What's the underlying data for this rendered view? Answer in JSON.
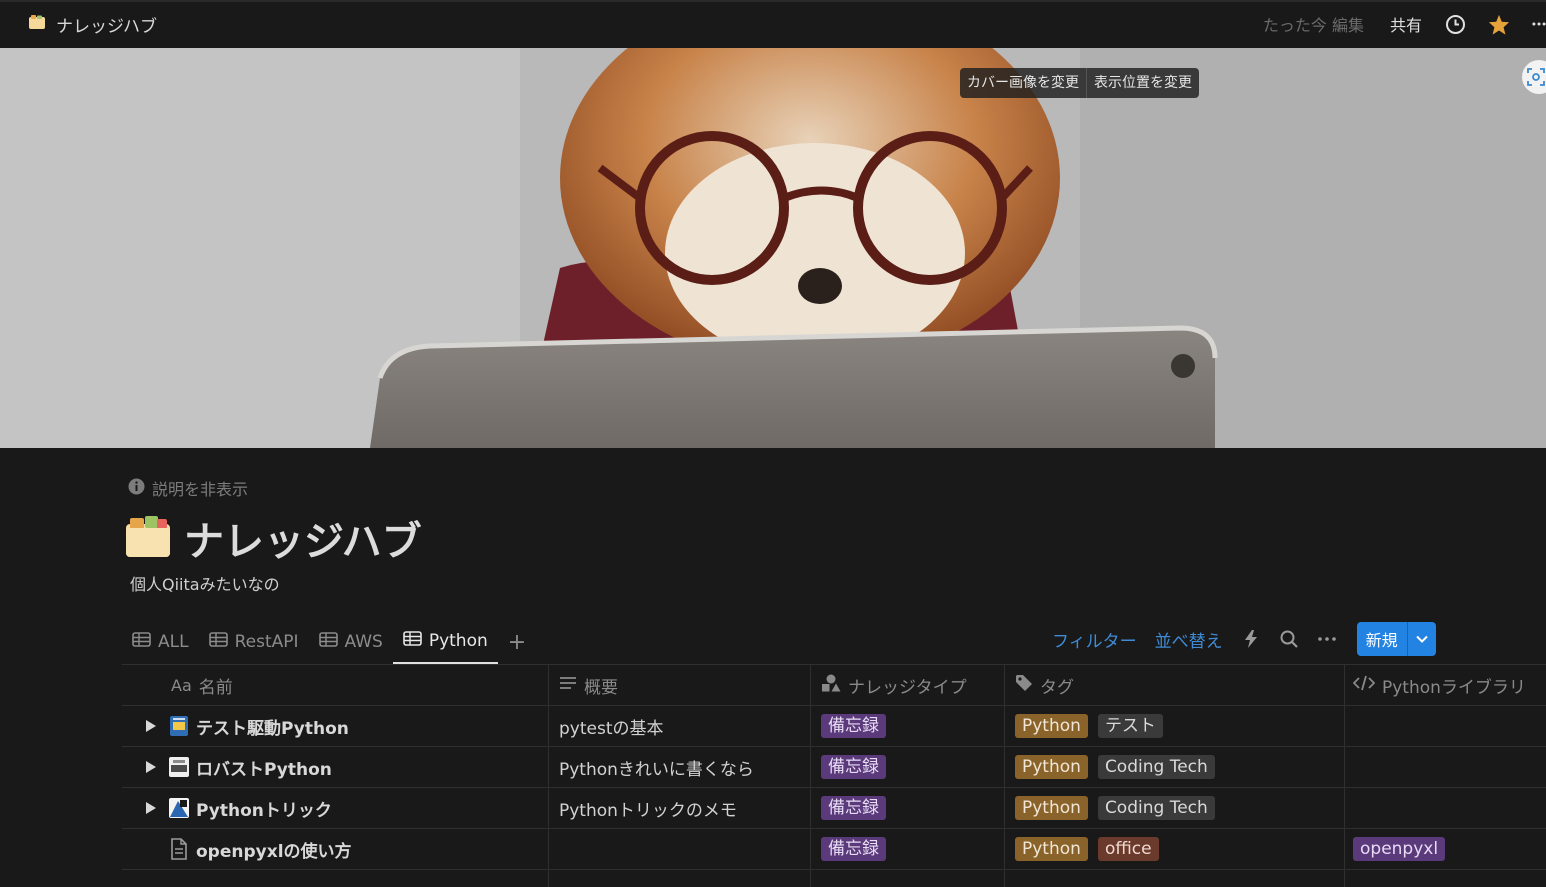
{
  "topbar": {
    "breadcrumb": "ナレッジハブ",
    "edited": "たった今 編集",
    "share": "共有"
  },
  "cover": {
    "change_cover": "カバー画像を変更",
    "reposition": "表示位置を変更"
  },
  "page": {
    "hide_description": "説明を非表示",
    "title": "ナレッジハブ",
    "description": "個人Qiitaみたいなの"
  },
  "views": {
    "tabs": [
      {
        "label": "ALL"
      },
      {
        "label": "RestAPI"
      },
      {
        "label": "AWS"
      },
      {
        "label": "Python",
        "active": true
      }
    ],
    "filter": "フィルター",
    "sort": "並べ替え",
    "new": "新規"
  },
  "table": {
    "columns": [
      "名前",
      "概要",
      "ナレッジタイプ",
      "タグ",
      "Pythonライブラリ"
    ],
    "name_prefix": "Aa",
    "rows": [
      {
        "name": "テスト駆動Python",
        "summary": "pytestの基本",
        "type": "備忘録",
        "tags": [
          "Python",
          "テスト"
        ],
        "library": ""
      },
      {
        "name": "ロバストPython",
        "summary": "Pythonきれいに書くなら",
        "type": "備忘録",
        "tags": [
          "Python",
          "Coding Tech"
        ],
        "library": ""
      },
      {
        "name": "Pythonトリック",
        "summary": "Pythonトリックのメモ",
        "type": "備忘録",
        "tags": [
          "Python",
          "Coding Tech"
        ],
        "library": ""
      },
      {
        "name": "openpyxlの使い方",
        "summary": "",
        "type": "備忘録",
        "tags": [
          "Python",
          "office"
        ],
        "library": "openpyxl"
      }
    ]
  },
  "colors": {
    "accent": "#2383e2",
    "link": "#3f8bd6",
    "star": "#e6a33a",
    "tag_python": "#89632a",
    "tag_memo": "#5a3a7a"
  }
}
